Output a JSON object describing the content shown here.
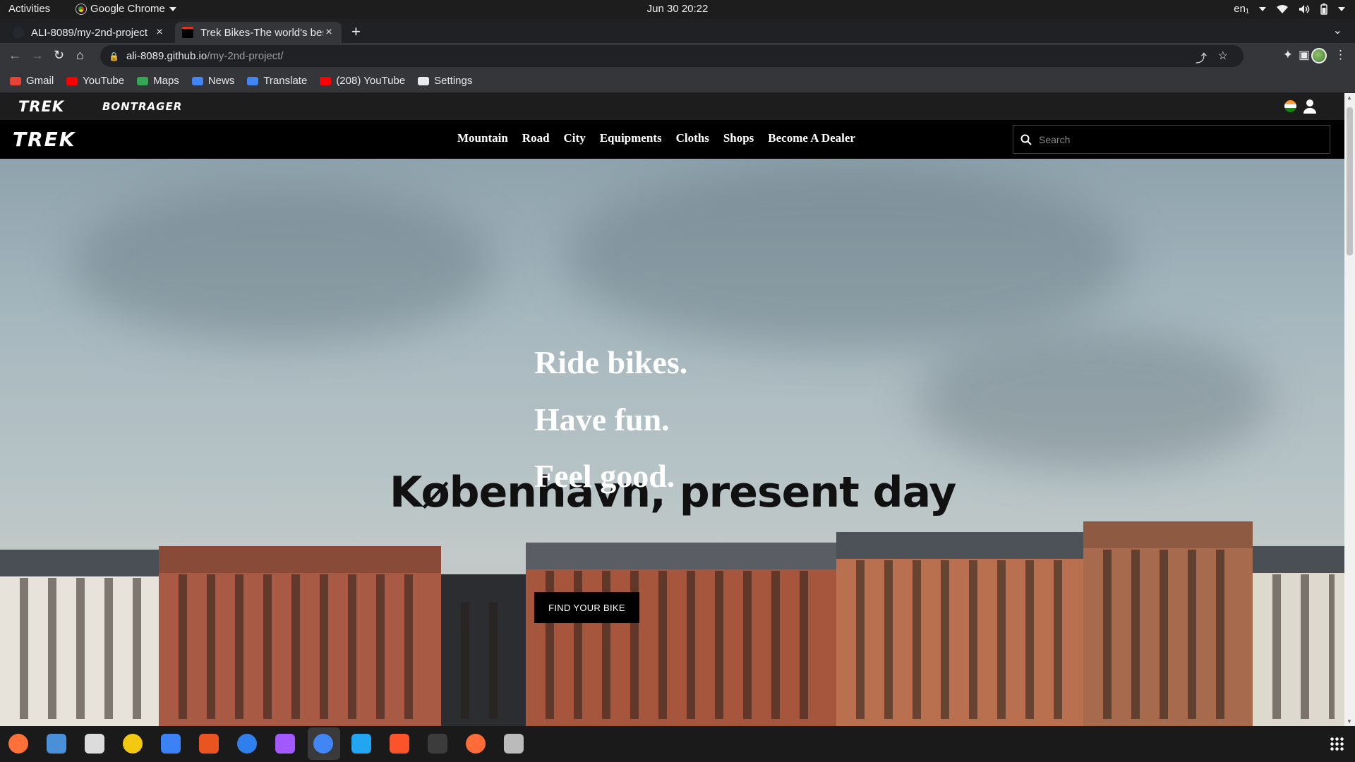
{
  "system": {
    "activities": "Activities",
    "app_name": "Google Chrome",
    "clock": "Jun 30  20:22",
    "lang": "en₁"
  },
  "tabs": [
    {
      "title": "ALI-8089/my-2nd-project",
      "active": false
    },
    {
      "title": "Trek Bikes-The world's best bikes",
      "active": true
    }
  ],
  "address_bar": {
    "host": "ali-8089.github.io",
    "path": "/my-2nd-project/"
  },
  "bookmarks": [
    {
      "label": "Gmail",
      "icon": "gmail-icon",
      "color": "#ea4335"
    },
    {
      "label": "YouTube",
      "icon": "youtube-icon",
      "color": "#ff0000"
    },
    {
      "label": "Maps",
      "icon": "maps-icon",
      "color": "#34a853"
    },
    {
      "label": "News",
      "icon": "news-icon",
      "color": "#4285f4"
    },
    {
      "label": "Translate",
      "icon": "translate-icon",
      "color": "#4285f4"
    },
    {
      "label": "(208) YouTube",
      "icon": "youtube-icon",
      "color": "#ff0000"
    },
    {
      "label": "Settings",
      "icon": "gear-icon",
      "color": "#e8eaed"
    }
  ],
  "site": {
    "top_brands": [
      "TREK",
      "BONTRAGER"
    ],
    "logo": "TREK",
    "nav": [
      "Mountain",
      "Road",
      "City",
      "Equipments",
      "Cloths",
      "Shops",
      "Become A Dealer"
    ],
    "search_placeholder": "Search",
    "hero": {
      "overlay_title": "København, present day",
      "lines": [
        "Ride bikes.",
        "Have fun.",
        "Feel good."
      ],
      "cta": "FIND YOUR BIKE"
    }
  },
  "dock": [
    {
      "name": "firefox-icon",
      "color": "#ff7139"
    },
    {
      "name": "thunderbird-icon",
      "color": "#4a90d9"
    },
    {
      "name": "files-icon",
      "color": "#dcdcdc"
    },
    {
      "name": "rhythmbox-icon",
      "color": "#f2c811"
    },
    {
      "name": "writer-icon",
      "color": "#3b82f6"
    },
    {
      "name": "software-center-icon",
      "color": "#e95420"
    },
    {
      "name": "help-icon",
      "color": "#2f80ed"
    },
    {
      "name": "figma-icon",
      "color": "#a259ff"
    },
    {
      "name": "chrome-icon",
      "color": "#4285f4"
    },
    {
      "name": "vscode-icon",
      "color": "#22a6f2"
    },
    {
      "name": "brave-icon",
      "color": "#fb542b"
    },
    {
      "name": "terminal-icon",
      "color": "#3c3c3c"
    },
    {
      "name": "postman-icon",
      "color": "#ff6c37"
    },
    {
      "name": "image-viewer-icon",
      "color": "#bbbbbb"
    }
  ]
}
